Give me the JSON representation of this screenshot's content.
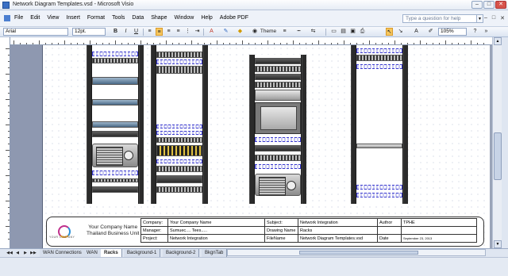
{
  "window": {
    "title": "Network Diagram Templates.vsd - Microsoft Visio"
  },
  "menubar": {
    "items": [
      "File",
      "Edit",
      "View",
      "Insert",
      "Format",
      "Tools",
      "Data",
      "Shape",
      "Window",
      "Help",
      "Adobe PDF"
    ],
    "help_placeholder": "Type a question for help"
  },
  "toolbar": {
    "font": "Arial",
    "size": "12pt.",
    "bold": "B",
    "italic": "I",
    "underline": "U",
    "theme": "Theme",
    "zoom": "105%"
  },
  "titleblock": {
    "logo_text": "YOUR COMPANY",
    "company_line1": "Your Company Name",
    "company_line2": "Thailand Business Unit",
    "rows": [
      [
        "Company:",
        "Your Company Name",
        "Subject:",
        "Network Integration",
        "Author",
        "TPHE"
      ],
      [
        "Manager:",
        "Sumuec.... Tees.....",
        "Drawing Name",
        "Racks",
        "",
        ""
      ],
      [
        "Project:",
        "Network Integration",
        "FileName",
        "Network Diagram Templates.vsd",
        "Date",
        "September 23, 2013"
      ]
    ]
  },
  "tabs": {
    "items": [
      "WAN Connections",
      "WAN",
      "Racks",
      "Background-1",
      "Background-2",
      "BkgnTab"
    ],
    "active": "Racks"
  }
}
